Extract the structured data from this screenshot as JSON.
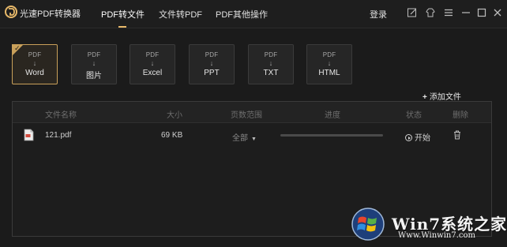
{
  "app": {
    "title": "光速PDF转换器"
  },
  "nav": {
    "tabs": [
      {
        "label": "PDF转文件"
      },
      {
        "label": "文件转PDF"
      },
      {
        "label": "PDF其他操作"
      }
    ],
    "active_tab": 0,
    "login_label": "登录",
    "window_icons": [
      "edit-icon",
      "shirt-icon",
      "bell-icon",
      "menu-icon",
      "minimize-icon",
      "maximize-icon",
      "close-icon"
    ]
  },
  "formats": [
    {
      "from": "PDF",
      "arrow": "↓",
      "to": "Word",
      "selected": true
    },
    {
      "from": "PDF",
      "arrow": "↓",
      "to": "图片"
    },
    {
      "from": "PDF",
      "arrow": "↓",
      "to": "Excel"
    },
    {
      "from": "PDF",
      "arrow": "↓",
      "to": "PPT"
    },
    {
      "from": "PDF",
      "arrow": "↓",
      "to": "TXT"
    },
    {
      "from": "PDF",
      "arrow": "↓",
      "to": "HTML"
    }
  ],
  "add_file_label": "添加文件",
  "table": {
    "headers": [
      "文件名称",
      "大小",
      "页数范围",
      "进度",
      "状态",
      "删除"
    ],
    "rows": [
      {
        "name": "121.pdf",
        "size": "69 KB",
        "pages": "全部",
        "progress": 0,
        "status": "开始"
      }
    ]
  },
  "watermark": {
    "brand": "Win7系统之家",
    "url": "Www.Winwin7.com"
  },
  "colors": {
    "background": "#1b1b1b",
    "accent_gold": "#c9a05a",
    "text": "#d8d8d8",
    "muted": "#6e6e6e"
  }
}
